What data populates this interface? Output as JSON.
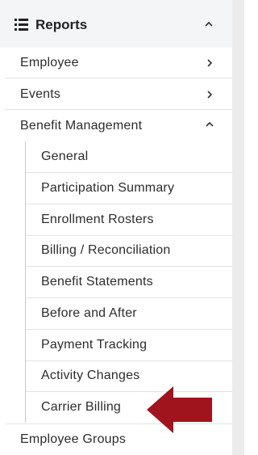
{
  "header": {
    "title": "Reports",
    "icon": "list-icon",
    "toggle_icon": "chevron-up-icon"
  },
  "menu": {
    "items": [
      {
        "label": "Employee",
        "icon": "chevron-right-icon"
      },
      {
        "label": "Events",
        "icon": "chevron-right-icon"
      },
      {
        "label": "Benefit Management",
        "icon": "chevron-up-icon"
      }
    ],
    "benefit_management_subitems": [
      "General",
      "Participation Summary",
      "Enrollment Rosters",
      "Billing / Reconciliation",
      "Benefit Statements",
      "Before and After",
      "Payment Tracking",
      "Activity Changes",
      "Carrier Billing"
    ],
    "bottom_item": {
      "label": "Employee Groups"
    }
  },
  "annotation": {
    "arrow_color": "#a0141e",
    "points_to": "Carrier Billing"
  },
  "colors": {
    "header_bg": "#f4f5f6",
    "divider": "#e3e3e3",
    "text": "#2d2d2d",
    "gutter": "#ececec"
  }
}
